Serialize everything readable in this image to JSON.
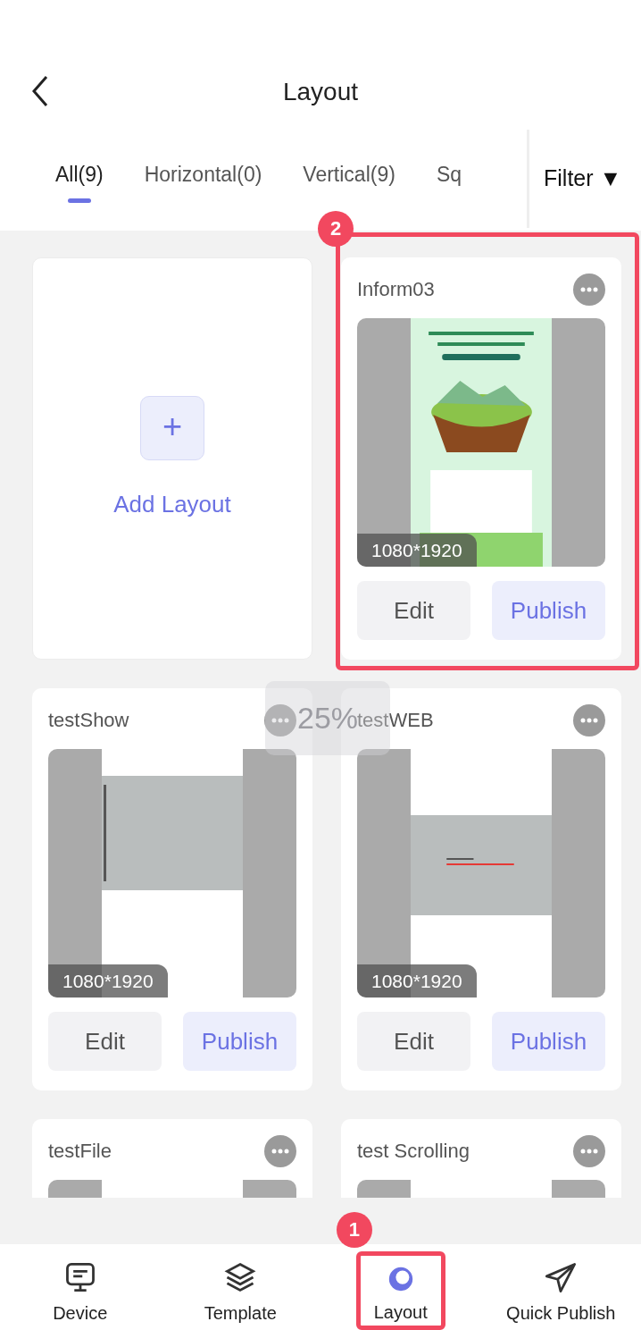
{
  "header": {
    "title": "Layout"
  },
  "tabs": [
    {
      "label": "All(9)",
      "selected": true
    },
    {
      "label": "Horizontal(0)",
      "selected": false
    },
    {
      "label": "Vertical(9)",
      "selected": false
    },
    {
      "label": "Sq",
      "selected": false
    }
  ],
  "filter": {
    "label": "Filter",
    "caret": "▼"
  },
  "add_card": {
    "symbol": "+",
    "label": "Add Layout"
  },
  "layouts": [
    {
      "name": "Inform03",
      "kind": "poster",
      "resolution": "1080*1920",
      "edit": "Edit",
      "publish": "Publish",
      "marker": "2"
    },
    {
      "name": "testShow",
      "kind": "vertical_text",
      "resolution": "1080*1920",
      "edit": "Edit",
      "publish": "Publish"
    },
    {
      "name": "testWEB",
      "kind": "web",
      "resolution": "1080*1920",
      "edit": "Edit",
      "publish": "Publish"
    },
    {
      "name": "testFile",
      "kind": "plain"
    },
    {
      "name": "test Scrolling",
      "kind": "plain"
    }
  ],
  "toast": "25%",
  "nav": [
    {
      "label": "Device",
      "selected": false
    },
    {
      "label": "Template",
      "selected": false
    },
    {
      "label": "Layout",
      "selected": true,
      "marker": "1"
    },
    {
      "label": "Quick Publish",
      "selected": false
    }
  ]
}
